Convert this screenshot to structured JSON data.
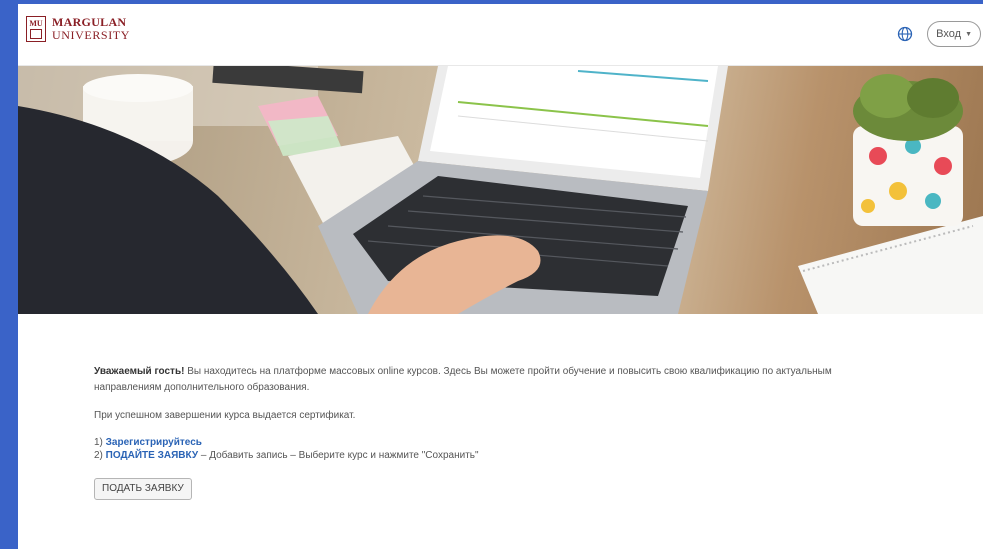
{
  "header": {
    "logo_line1": "MARGULAN",
    "logo_line2": "UNIVERSITY",
    "logo_mark": "MU",
    "language_icon": "globe-icon",
    "login_label": "Вход",
    "login_caret_icon": "caret-down-icon"
  },
  "intro": {
    "greeting": "Уважаемый гость!",
    "text": " Вы находитесь на платформе массовых online курсов. Здесь Вы можете пройти обучение и повысить свою квалификацию по актуальным направлениям дополнительного образования."
  },
  "certificate_note": "При успешном завершении курса выдается сертификат.",
  "steps": {
    "step1_prefix": "1) ",
    "step1_link": "Зарегистрируйтесь",
    "step2_prefix": "2) ",
    "step2_link": "ПОДАЙТЕ ЗАЯВКУ",
    "step2_text": " – Добавить запись – Выберите курс и нажмите \"Сохранить\""
  },
  "submit_button_label": "ПОДАТЬ ЗАЯВКУ",
  "colors": {
    "page_border": "#3a63c8",
    "brand": "#8a1f25",
    "link": "#2a63b5"
  }
}
